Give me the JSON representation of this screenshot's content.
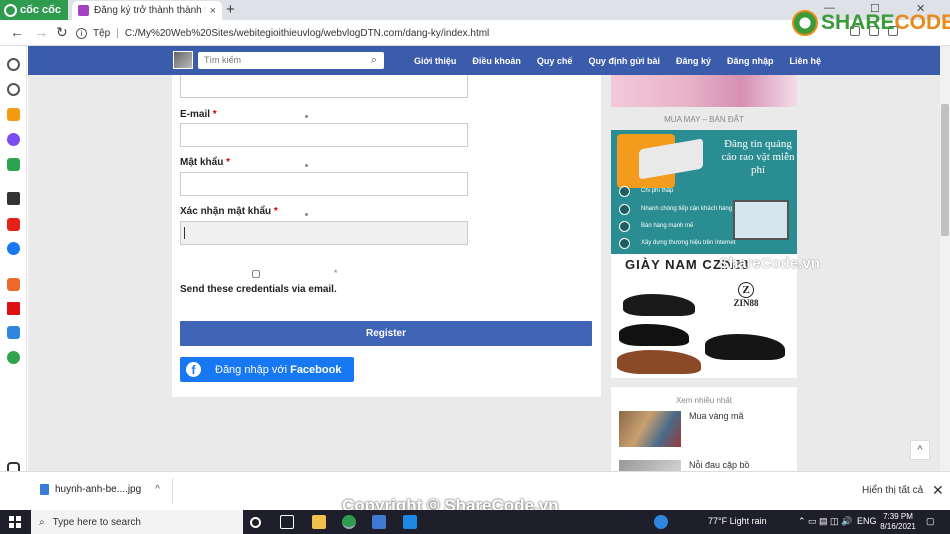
{
  "browser": {
    "brand": "cốc cốc",
    "tab_title": "Đăng ký trở thành thành viên",
    "tab_close": "×",
    "new_tab": "+",
    "url_scheme_label": "Tệp",
    "url": "C:/My%20Web%20Sites/webitegioithieuvlog/webvlogDTN.com/dang-ky/index.html",
    "window_controls": [
      "—",
      "☐",
      "✕"
    ]
  },
  "watermark": {
    "logo_text_main": "SHARE",
    "logo_text_accent": "CODE.vn",
    "image_watermark": "ShareCode.vn",
    "copyright": "Copyright © ShareCode.vn"
  },
  "topnav": {
    "search_placeholder": "Tìm kiếm",
    "links": [
      "Giới thiệu",
      "Điều khoản",
      "Quy chế",
      "Quy định gửi bài",
      "Đăng ký",
      "Đăng nhập",
      "Liên hệ"
    ]
  },
  "form": {
    "email_label": "E-mail",
    "password_label": "Mật khẩu",
    "confirm_label": "Xác nhận mật khẩu",
    "required_mark": "*",
    "send_label": "Send these credentials via email.",
    "register_label": "Register",
    "facebook_prefix": "Đăng nhập với ",
    "facebook_brand": "Facebook"
  },
  "sidebar_right": {
    "ad_caption": "MUA MAY – BÁN ĐẤT",
    "ad_blue_title": "Đăng tin quảng cáo rao vặt miễn phí",
    "ad_blue_rows": [
      "Chi phí thấp",
      "Nhanh chóng tiếp cận khách hàng",
      "Bán hàng mạnh mẽ",
      "Xây dựng thương hiệu trên Internet"
    ],
    "ad_shoes_title_left": "GIÀY NAM C",
    "ad_shoes_title_right": "ZIN88",
    "ad_shoes_brand": "ZIN88",
    "popular_title": "Xem nhiều nhất",
    "popular_items": [
      "Mua vàng mã",
      "Nỗi đau cặp bồ"
    ]
  },
  "download": {
    "file": "huynh-anh-be....jpg",
    "chevron": "^",
    "show_all": "Hiển thị tất cả",
    "close": "✕"
  },
  "taskbar": {
    "search_placeholder": "Type here to search",
    "weather": "77°F  Light rain",
    "lang": "ENG",
    "time": "7:39 PM",
    "date": "8/16/2021"
  },
  "colors": {
    "nav_blue": "#3b5bab",
    "register_blue": "#3e63b7",
    "facebook_blue": "#1877f2",
    "required_red": "#cc0000",
    "brand_green": "#2e9b4f"
  },
  "icons": [
    "cococ-logo-icon",
    "favicon-icon",
    "back-arrow-icon",
    "forward-arrow-icon",
    "reload-icon",
    "info-icon",
    "search-icon",
    "facebook-icon",
    "file-icon",
    "chevron-up-icon",
    "windows-start-icon"
  ]
}
